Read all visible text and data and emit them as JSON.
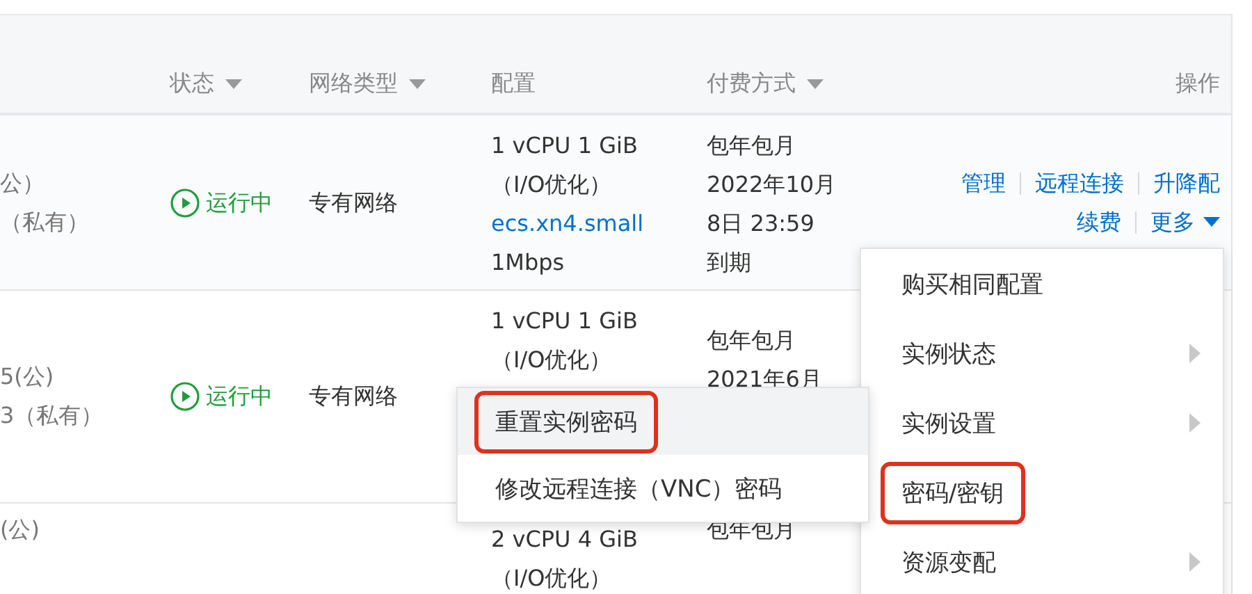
{
  "table": {
    "columns": [
      {
        "label": "状态",
        "filter": true
      },
      {
        "label": "网络类型",
        "filter": true
      },
      {
        "label": "配置",
        "filter": false
      },
      {
        "label": "付费方式",
        "filter": true
      },
      {
        "label": "操作",
        "filter": false
      }
    ],
    "rows": [
      {
        "address": [
          "公）",
          "（私有）"
        ],
        "status": {
          "label": "运行中",
          "kind": "running"
        },
        "network": "专有网络",
        "config": [
          {
            "text": "1 vCPU 1 GiB",
            "link": false
          },
          {
            "text": "（I/O优化）",
            "link": false
          },
          {
            "text": "ecs.xn4.small",
            "link": true
          },
          {
            "text": "1Mbps",
            "link": false
          }
        ],
        "billing": [
          "包年包月",
          "2022年10月",
          "8日 23:59",
          "到期"
        ],
        "actions": [
          [
            {
              "label": "管理",
              "dropdown": false
            },
            {
              "label": "远程连接",
              "dropdown": false
            },
            {
              "label": "升降配",
              "dropdown": false
            }
          ],
          [
            {
              "label": "续费",
              "dropdown": false
            },
            {
              "label": "更多",
              "dropdown": true
            }
          ]
        ]
      },
      {
        "address": [
          "5(公)",
          "3（私有）"
        ],
        "status": {
          "label": "运行中",
          "kind": "running"
        },
        "network": "专有网络",
        "config": [
          {
            "text": "1 vCPU 1 GiB",
            "link": false
          },
          {
            "text": "（I/O优化）",
            "link": false
          }
        ],
        "billing": [
          "包年包月",
          "2021年6月"
        ]
      },
      {
        "address": [
          "(公)"
        ],
        "config": [
          {
            "text": "2 vCPU 4 GiB",
            "link": false
          },
          {
            "text": "（I/O优化）",
            "link": false
          }
        ],
        "billing": [
          "包年包月"
        ]
      }
    ]
  },
  "more_menu": {
    "items": [
      {
        "label": "购买相同配置",
        "submenu": false,
        "annotated": false
      },
      {
        "label": "实例状态",
        "submenu": true,
        "annotated": false
      },
      {
        "label": "实例设置",
        "submenu": true,
        "annotated": false
      },
      {
        "label": "密码/密钥",
        "submenu": false,
        "annotated": true
      },
      {
        "label": "资源变配",
        "submenu": true,
        "annotated": false
      }
    ]
  },
  "submenu": {
    "items": [
      {
        "label": "重置实例密码",
        "hovered": true,
        "annotated": true
      },
      {
        "label": "修改远程连接（VNC）密码",
        "hovered": false,
        "annotated": false
      }
    ]
  }
}
